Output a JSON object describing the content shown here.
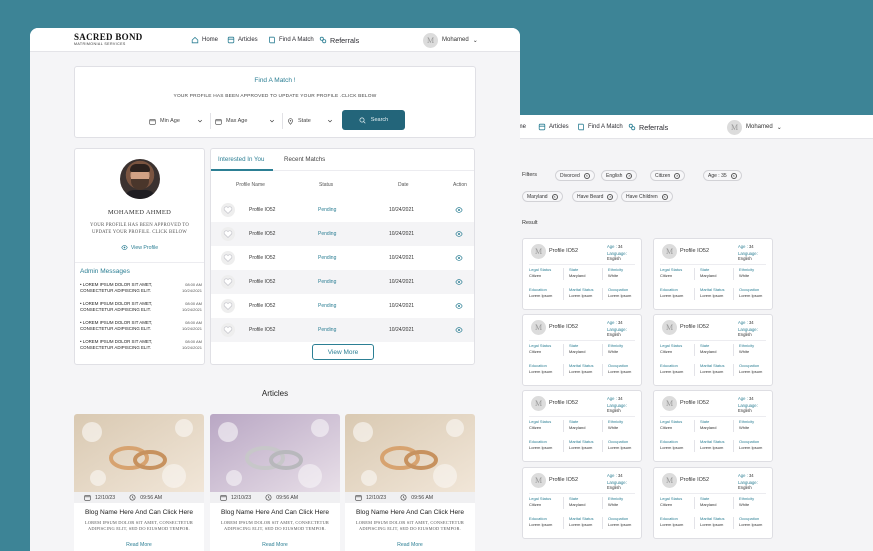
{
  "brand": {
    "title": "SACRED BOND",
    "subtitle": "MATRIMONIAL SERVICES"
  },
  "nav": {
    "home": "Home",
    "articles": "Articles",
    "find_match": "Find A Match",
    "referrals": "Referrals",
    "user": "Mohamed",
    "avatar_letter": "M"
  },
  "find": {
    "title": "Find A Match !",
    "subtitle": "YOUR PROFILE HAS BEEN APPROVED TO UPDATE YOUR PROFILE .CLICK BELOW",
    "min_age": "Min Age",
    "max_age": "Max Age",
    "state": "State",
    "search": "Search"
  },
  "profile": {
    "name": "MOHAMED AHMED",
    "message": "YOUR PROFILE HAS BEEN APPROVED TO UPDATE YOUR PROFILE. CLICK BELOW",
    "view_profile": "View Profile"
  },
  "admin": {
    "title": "Admin Messages",
    "items": [
      {
        "text": "LOREM IPSUM DOLOR SIT AMET, CONSECTETUR ADIPISCING ELIT.",
        "time": "08:00 AM",
        "date": "10/24/2021"
      },
      {
        "text": "LOREM IPSUM DOLOR SIT AMET, CONSECTETUR ADIPISCING ELIT.",
        "time": "08:00 AM",
        "date": "10/24/2021"
      },
      {
        "text": "LOREM IPSUM DOLOR SIT AMET, CONSECTETUR ADIPISCING ELIT.",
        "time": "08:00 AM",
        "date": "10/24/2021"
      },
      {
        "text": "LOREM IPSUM DOLOR SIT AMET, CONSECTETUR ADIPISCING ELIT.",
        "time": "08:00 AM",
        "date": "10/24/2021"
      }
    ]
  },
  "matches": {
    "tabs": [
      "Interested In You",
      "Recent Matchs"
    ],
    "headers": [
      "Profile Name",
      "Status",
      "Date",
      "Action"
    ],
    "rows": [
      {
        "name": "Profile IO52",
        "status": "Pending",
        "date": "10/24/2021"
      },
      {
        "name": "Profile IO52",
        "status": "Pending",
        "date": "10/24/2021"
      },
      {
        "name": "Profile IO52",
        "status": "Pending",
        "date": "10/24/2021"
      },
      {
        "name": "Profile IO52",
        "status": "Pending",
        "date": "10/24/2021"
      },
      {
        "name": "Profile IO52",
        "status": "Pending",
        "date": "10/24/2021"
      },
      {
        "name": "Profile IO52",
        "status": "Pending",
        "date": "10/24/2021"
      }
    ],
    "view_more": "View More"
  },
  "articles": {
    "title": "Articles",
    "items": [
      {
        "date": "12/10/23",
        "time": "09:56 AM",
        "title": "Blog Name Here And Can Click Here",
        "desc": "LOREM IPSUM DOLOR SIT AMET, CONSECTETUR ADIPISCING ELIT, SED DO EIUSMOD TEMPOR.",
        "link": "Read More"
      },
      {
        "date": "12/10/23",
        "time": "09:56 AM",
        "title": "Blog Name Here And Can Click Here",
        "desc": "LOREM IPSUM DOLOR SIT AMET, CONSECTETUR ADIPISCING ELIT, SED DO EIUSMOD TEMPOR.",
        "link": "Read More"
      },
      {
        "date": "12/10/23",
        "time": "09:56 AM",
        "title": "Blog Name Here And Can Click Here",
        "desc": "LOREM IPSUM DOLOR SIT AMET, CONSECTETUR ADIPISCING ELIT, SED DO EIUSMOD TEMPOR.",
        "link": "Read More"
      }
    ]
  },
  "back": {
    "nav": {
      "home": "Home",
      "articles": "Articles",
      "find_match": "Find A Match",
      "referrals": "Referrals",
      "user": "Mohamed",
      "avatar_letter": "M"
    },
    "filters_label": "Filters",
    "filters": [
      "Divorced",
      "English",
      "Citizen",
      "Age : 35",
      "Maryland",
      "Have Beard",
      "Have Children"
    ],
    "result_label": "Result",
    "card": {
      "avatar_letter": "M",
      "name": "Profile IO52",
      "age_key": "Age :",
      "age_val": "34",
      "lang_key": "Language:",
      "lang_val": "English",
      "legal_key": "Legal Status",
      "legal_val": "Citizen",
      "state_key": "State",
      "state_val": "Maryland",
      "eth_key": "Ethnicity",
      "eth_val": "White",
      "edu_key": "Education",
      "edu_val": "Lorem Ipsum",
      "mar_key": "Marital Status",
      "mar_val": "Lorem Ipsum",
      "occ_key": "Occupation",
      "occ_val": "Lorem Ipsum"
    }
  },
  "colors": {
    "accent": "#2c7f94",
    "search_button": "#23657a",
    "background": "#3d8496"
  }
}
